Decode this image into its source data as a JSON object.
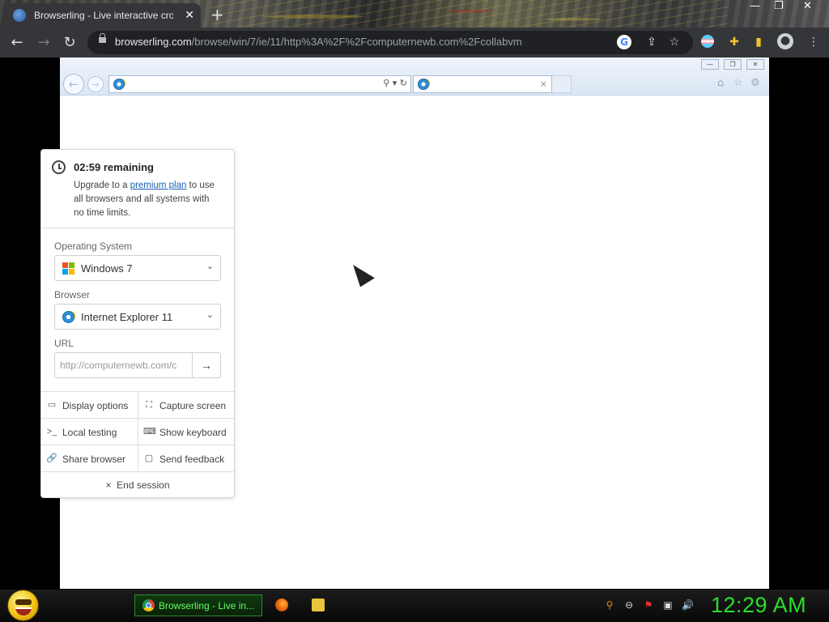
{
  "chrome": {
    "tab_title": "Browserling - Live interactive cro",
    "tab_close": "✕",
    "new_tab": "+",
    "minimize": "—",
    "maximize": "❐",
    "close": "✕",
    "url_host": "browserling.com",
    "url_path": "/browse/win/7/ie/11/http%3A%2F%2Fcomputernewb.com%2Fcollabvm",
    "back_icon": "arrow-left-icon",
    "forward_icon": "arrow-right-icon",
    "reload_icon": "reload-icon",
    "google_letter": "G"
  },
  "ie": {
    "address_value": "",
    "tab_close": "×"
  },
  "panel": {
    "remaining": "02:59 remaining",
    "upgrade_prefix": "Upgrade to a ",
    "upgrade_link": "premium plan",
    "upgrade_suffix": " to use all browsers and all systems with no time limits.",
    "os_label": "Operating System",
    "os_value": "Windows 7",
    "browser_label": "Browser",
    "browser_value": "Internet Explorer 11",
    "url_label": "URL",
    "url_value": "http://computernewb.com/c",
    "go": "→",
    "buttons": [
      {
        "label": "Display options",
        "icon": "▭"
      },
      {
        "label": "Capture screen",
        "icon": "⛶"
      },
      {
        "label": "Local testing",
        "icon": ">_"
      },
      {
        "label": "Show keyboard",
        "icon": "⌨"
      },
      {
        "label": "Share browser",
        "icon": "🔗"
      },
      {
        "label": "Send feedback",
        "icon": "▢"
      }
    ],
    "end_session": "End session",
    "end_icon": "×"
  },
  "taskbar": {
    "task_label": "Browserling - Live in...",
    "clock": "12:29 AM"
  },
  "colors": {
    "clock_green": "#28e028",
    "link_blue": "#1a5fb4",
    "chrome_dark": "#35363a"
  }
}
